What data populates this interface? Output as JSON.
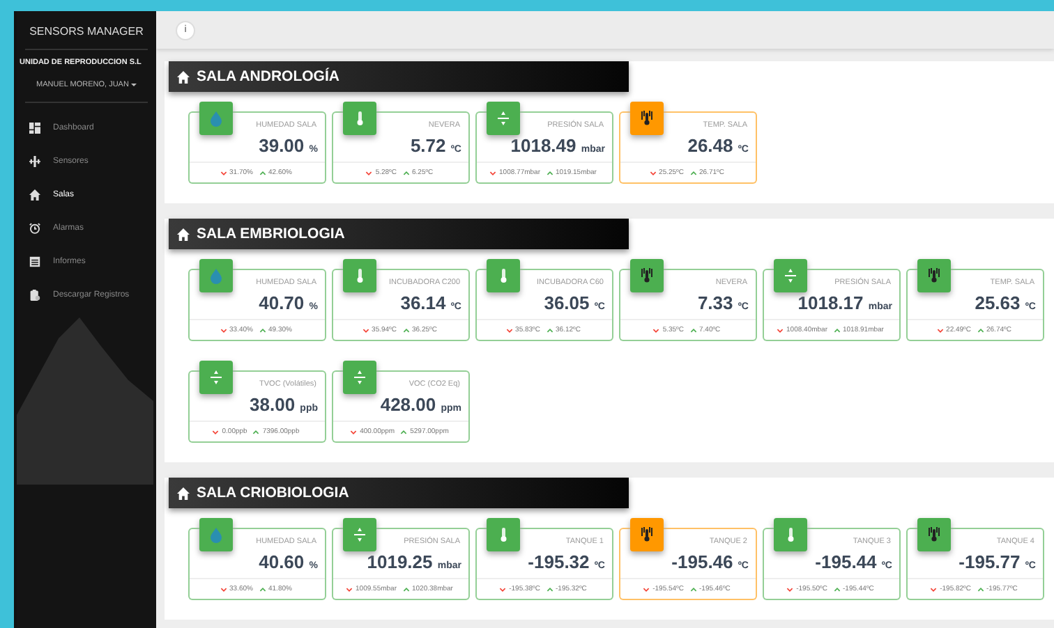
{
  "sidebar": {
    "title": "SENSORS MANAGER",
    "company": "UNIDAD DE REPRODUCCION S.L",
    "user": "MANUEL MORENO, JUAN",
    "items": [
      {
        "label": "Dashboard",
        "kind": "dashboard",
        "selected": false
      },
      {
        "label": "Sensores",
        "kind": "sensor",
        "selected": false
      },
      {
        "label": "Salas",
        "kind": "home",
        "selected": true
      },
      {
        "label": "Alarmas",
        "kind": "alarm",
        "selected": false
      },
      {
        "label": "Informes",
        "kind": "report",
        "selected": false
      },
      {
        "label": "Descargar Registros",
        "kind": "download",
        "selected": false
      }
    ]
  },
  "topbar": {
    "button": "i"
  },
  "sections": [
    {
      "title": "SALA ANDROLOGÍA",
      "rows": [
        [
          {
            "label": "HUMEDAD SALA",
            "kind": "drop",
            "color": "#4caf50",
            "value": "39.00",
            "unit": "%",
            "min": "31.70%",
            "max": "42.60%"
          },
          {
            "label": "NEVERA",
            "kind": "thermometer",
            "color": "#4caf50",
            "value": "5.72",
            "unit": "ºC",
            "min": "5.28ºC",
            "max": "6.25ºC"
          },
          {
            "label": "PRESIÓN SALA",
            "kind": "pressure",
            "color": "#4caf50",
            "value": "1018.49",
            "unit": "mbar",
            "min": "1008.77mbar",
            "max": "1019.15mbar"
          },
          {
            "label": "TEMP. SALA",
            "kind": "probe",
            "color": "#ff9800",
            "value": "26.48",
            "unit": "ºC",
            "min": "25.25ºC",
            "max": "26.71ºC"
          }
        ]
      ]
    },
    {
      "title": "SALA EMBRIOLOGIA",
      "rows": [
        [
          {
            "label": "HUMEDAD SALA",
            "kind": "drop",
            "color": "#4caf50",
            "value": "40.70",
            "unit": "%",
            "min": "33.40%",
            "max": "49.30%"
          },
          {
            "label": "INCUBADORA C200",
            "kind": "thermometer",
            "color": "#4caf50",
            "value": "36.14",
            "unit": "ºC",
            "min": "35.94ºC",
            "max": "36.25ºC"
          },
          {
            "label": "INCUBADORA C60",
            "kind": "thermometer",
            "color": "#4caf50",
            "value": "36.05",
            "unit": "ºC",
            "min": "35.83ºC",
            "max": "36.12ºC"
          },
          {
            "label": "NEVERA",
            "kind": "probe",
            "color": "#4caf50",
            "value": "7.33",
            "unit": "ºC",
            "min": "5.35ºC",
            "max": "7.40ºC"
          },
          {
            "label": "PRESIÓN SALA",
            "kind": "pressure",
            "color": "#4caf50",
            "value": "1018.17",
            "unit": "mbar",
            "min": "1008.40mbar",
            "max": "1018.91mbar"
          },
          {
            "label": "TEMP. SALA",
            "kind": "probe",
            "color": "#4caf50",
            "value": "25.63",
            "unit": "ºC",
            "min": "22.49ºC",
            "max": "26.74ºC"
          }
        ],
        [
          {
            "label": "TVOC (Volátiles)",
            "kind": "pressure",
            "color": "#4caf50",
            "value": "38.00",
            "unit": "ppb",
            "min": "0.00ppb",
            "max": "7396.00ppb"
          },
          {
            "label": "VOC (CO2 Eq)",
            "kind": "pressure",
            "color": "#4caf50",
            "value": "428.00",
            "unit": "ppm",
            "min": "400.00ppm",
            "max": "5297.00ppm"
          }
        ]
      ]
    },
    {
      "title": "SALA CRIOBIOLOGIA",
      "rows": [
        [
          {
            "label": "HUMEDAD SALA",
            "kind": "drop",
            "color": "#4caf50",
            "value": "40.60",
            "unit": "%",
            "min": "33.60%",
            "max": "41.80%"
          },
          {
            "label": "PRESIÓN SALA",
            "kind": "pressure",
            "color": "#4caf50",
            "value": "1019.25",
            "unit": "mbar",
            "min": "1009.55mbar",
            "max": "1020.38mbar"
          },
          {
            "label": "TANQUE 1",
            "kind": "thermometer",
            "color": "#4caf50",
            "value": "-195.32",
            "unit": "ºC",
            "min": "-195.38ºC",
            "max": "-195.32ºC"
          },
          {
            "label": "TANQUE 2",
            "kind": "probe",
            "color": "#ff9800",
            "value": "-195.46",
            "unit": "ºC",
            "min": "-195.54ºC",
            "max": "-195.46ºC"
          },
          {
            "label": "TANQUE 3",
            "kind": "thermometer",
            "color": "#4caf50",
            "value": "-195.44",
            "unit": "ºC",
            "min": "-195.50ºC",
            "max": "-195.44ºC"
          },
          {
            "label": "TANQUE 4",
            "kind": "probe",
            "color": "#4caf50",
            "value": "-195.77",
            "unit": "ºC",
            "min": "-195.82ºC",
            "max": "-195.77ºC"
          }
        ]
      ]
    }
  ]
}
